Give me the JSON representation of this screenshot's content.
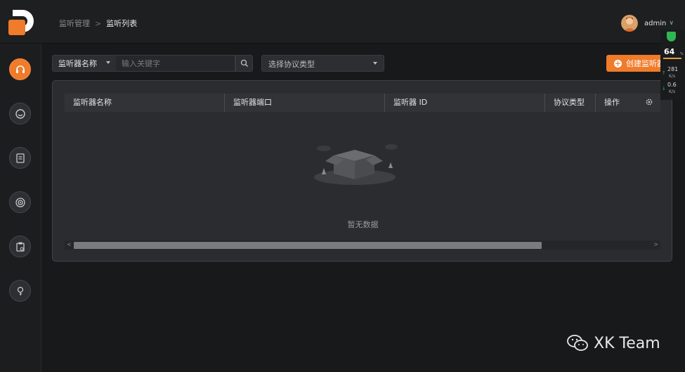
{
  "breadcrumb": {
    "parent": "监听管理",
    "separator": ">",
    "current": "监听列表"
  },
  "user": {
    "name": "admin",
    "chevron": "∨"
  },
  "sidebar": {
    "items": [
      {
        "icon": "headset-icon",
        "active": true
      },
      {
        "icon": "face-icon",
        "active": false
      },
      {
        "icon": "document-icon",
        "active": false
      },
      {
        "icon": "target-icon",
        "active": false
      },
      {
        "icon": "clipboard-icon",
        "active": false
      },
      {
        "icon": "key-icon",
        "active": false
      }
    ]
  },
  "filters": {
    "field_select": "监听器名称",
    "keyword_placeholder": "输入关键字",
    "protocol_placeholder": "选择协议类型"
  },
  "create_button": "创建监听器",
  "table": {
    "columns": [
      "监听器名称",
      "监听器端口",
      "监听器 ID",
      "协议类型",
      "操作"
    ],
    "empty_text": "暂无数据"
  },
  "net_monitor": {
    "percent": "64",
    "percent_sign": "%",
    "up_speed": "281",
    "up_unit": "K/s",
    "down_speed": "0.6",
    "down_unit": "K/s"
  },
  "watermark": "XK Team",
  "colors": {
    "accent": "#f07b2a",
    "background": "#18191b",
    "panel": "#2b2c2f"
  }
}
